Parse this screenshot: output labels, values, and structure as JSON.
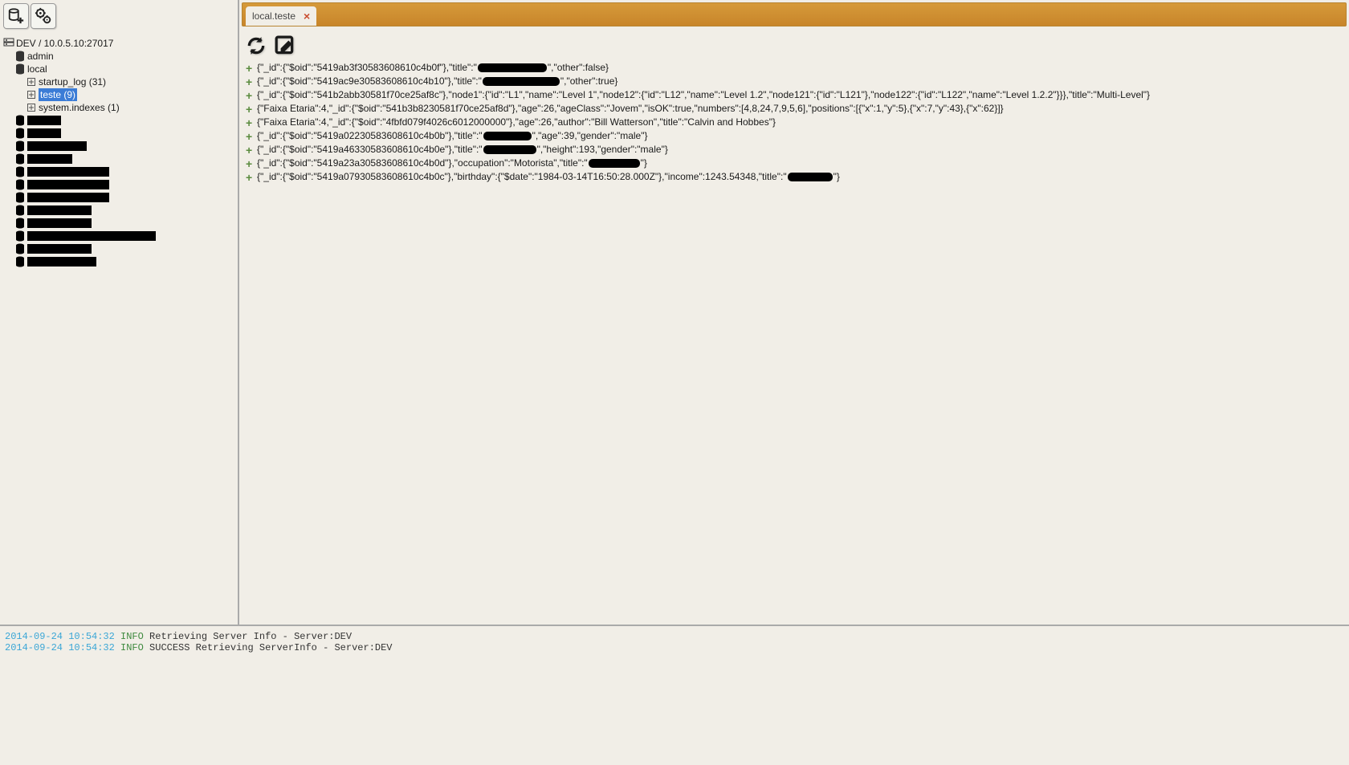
{
  "sidebar": {
    "server_label": "DEV / 10.0.5.10:27017",
    "databases": [
      {
        "name": "admin"
      },
      {
        "name": "local",
        "collections": [
          {
            "label": "startup_log (31)"
          },
          {
            "label": "teste (9)",
            "selected": true
          },
          {
            "label": "system.indexes (1)"
          }
        ]
      }
    ],
    "redacted_widths": [
      42,
      42,
      74,
      56,
      102,
      102,
      102,
      80,
      80,
      160,
      80,
      86
    ]
  },
  "tab": {
    "label": "local.teste"
  },
  "docs": [
    {
      "segments": [
        {
          "t": "{\"_id\":{\"$oid\":\"5419ab3f30583608610c4b0f\"},\"title\":\""
        },
        {
          "blob": 86
        },
        {
          "t": "\",\"other\":false}"
        }
      ]
    },
    {
      "segments": [
        {
          "t": "{\"_id\":{\"$oid\":\"5419ac9e30583608610c4b10\"},\"title\":\""
        },
        {
          "blob": 96
        },
        {
          "t": "\",\"other\":true}"
        }
      ]
    },
    {
      "segments": [
        {
          "t": "{\"_id\":{\"$oid\":\"541b2abb30581f70ce25af8c\"},\"node1\":{\"id\":\"L1\",\"name\":\"Level 1\",\"node12\":{\"id\":\"L12\",\"name\":\"Level 1.2\",\"node121\":{\"id\":\"L121\"},\"node122\":{\"id\":\"L122\",\"name\":\"Level 1.2.2\"}}},\"title\":\"Multi-Level\"}"
        }
      ]
    },
    {
      "segments": [
        {
          "t": "{\"Faixa Etaria\":4,\"_id\":{\"$oid\":\"541b3b8230581f70ce25af8d\"},\"age\":26,\"ageClass\":\"Jovem\",\"isOK\":true,\"numbers\":[4,8,24,7,9,5,6],\"positions\":[{\"x\":1,\"y\":5},{\"x\":7,\"y\":43},{\"x\":62}]}"
        }
      ]
    },
    {
      "segments": [
        {
          "t": "{\"Faixa Etaria\":4,\"_id\":{\"$oid\":\"4fbfd079f4026c6012000000\"},\"age\":26,\"author\":\"Bill Watterson\",\"title\":\"Calvin and Hobbes\"}"
        }
      ]
    },
    {
      "segments": [
        {
          "t": "{\"_id\":{\"$oid\":\"5419a02230583608610c4b0b\"},\"title\":\""
        },
        {
          "blob": 60
        },
        {
          "t": "\",\"age\":39,\"gender\":\"male\"}"
        }
      ]
    },
    {
      "segments": [
        {
          "t": "{\"_id\":{\"$oid\":\"5419a46330583608610c4b0e\"},\"title\":\""
        },
        {
          "blob": 66
        },
        {
          "t": "\",\"height\":193,\"gender\":\"male\"}"
        }
      ]
    },
    {
      "segments": [
        {
          "t": "{\"_id\":{\"$oid\":\"5419a23a30583608610c4b0d\"},\"occupation\":\"Motorista\",\"title\":\""
        },
        {
          "blob": 64
        },
        {
          "t": "\"}"
        }
      ]
    },
    {
      "segments": [
        {
          "t": "{\"_id\":{\"$oid\":\"5419a07930583608610c4b0c\"},\"birthday\":{\"$date\":\"1984-03-14T16:50:28.000Z\"},\"income\":1243.54348,\"title\":\""
        },
        {
          "blob": 56
        },
        {
          "t": "\"}"
        }
      ]
    }
  ],
  "log": [
    {
      "ts": "2014-09-24 10:54:32",
      "level": "INFO",
      "msg": "Retrieving Server Info - Server:DEV"
    },
    {
      "ts": "2014-09-24 10:54:32",
      "level": "INFO",
      "msg": "SUCCESS Retrieving ServerInfo - Server:DEV"
    }
  ]
}
